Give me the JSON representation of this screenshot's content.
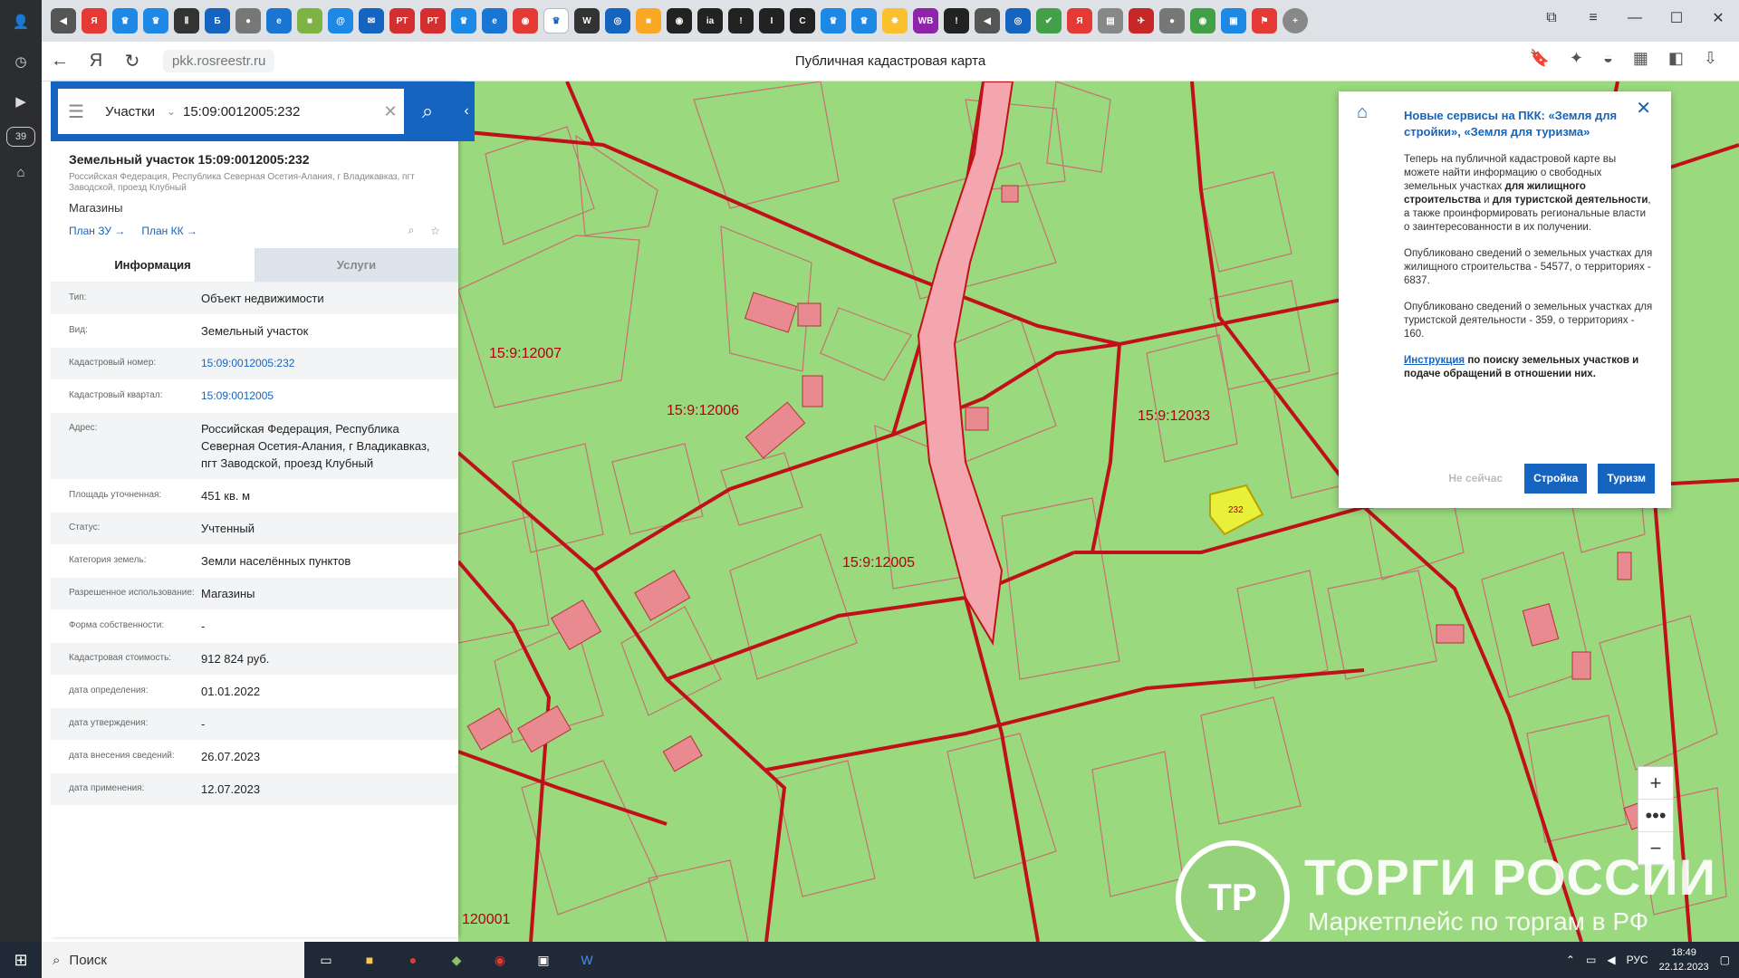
{
  "browser": {
    "url": "pkk.rosreestr.ru",
    "page_title": "Публичная кадастровая карта",
    "tab_count_badge": "39"
  },
  "search": {
    "category": "Участки",
    "query": "15:09:0012005:232"
  },
  "parcel": {
    "title": "Земельный участок 15:09:0012005:232",
    "address_short": "Российская Федерация, Республика Северная Осетия-Алания, г Владикавказ, пгт Заводской, проезд Клубный",
    "use": "Магазины",
    "plan_zu": "План ЗУ →",
    "plan_kk": "План КК →"
  },
  "tabs": {
    "info": "Информация",
    "services": "Услуги"
  },
  "info_rows": [
    {
      "key": "Тип:",
      "value": "Объект недвижимости"
    },
    {
      "key": "Вид:",
      "value": "Земельный участок"
    },
    {
      "key": "Кадастровый номер:",
      "value": "15:09:0012005:232"
    },
    {
      "key": "Кадастровый квартал:",
      "value": "15:09:0012005"
    },
    {
      "key": "Адрес:",
      "value": "Российская Федерация, Республика Северная Осетия-Алания, г Владикавказ, пгт Заводской, проезд Клубный"
    },
    {
      "key": "Площадь уточненная:",
      "value": "451 кв. м"
    },
    {
      "key": "Статус:",
      "value": "Учтенный"
    },
    {
      "key": "Категория земель:",
      "value": "Земли населённых пунктов"
    },
    {
      "key": "Разрешенное использование:",
      "value": "Магазины"
    },
    {
      "key": "Форма собственности:",
      "value": "-"
    },
    {
      "key": "Кадастровая стоимость:",
      "value": "912 824 руб."
    },
    {
      "key": "дата определения:",
      "value": "01.01.2022"
    },
    {
      "key": "дата утверждения:",
      "value": "-"
    },
    {
      "key": "дата внесения сведений:",
      "value": "26.07.2023"
    },
    {
      "key": "дата применения:",
      "value": "12.07.2023"
    }
  ],
  "map_labels": {
    "q1": "15:9:12007",
    "q2": "15:9:12006",
    "q3": "15:9:12005",
    "q4": "15:9:12033",
    "q5": "120001",
    "selected": "232"
  },
  "popup": {
    "title": "Новые сервисы на ПКК: «Земля для стройки», «Земля для туризма»",
    "p1_a": "Теперь на публичной кадастровой карте вы можете найти информацию о свободных земельных участках",
    "p1_b1": "для жилищного строительства",
    "p1_c": "и",
    "p1_b2": "для туристской деятельности",
    "p1_d": ", а также проинформировать региональные власти о заинтересованности в их получении.",
    "p2": "Опубликовано сведений о земельных участках для жилищного строительства - 54577, о территориях - 6837.",
    "p3": "Опубликовано сведений о земельных участках для туристской деятельности - 359, о территориях - 160.",
    "p4_link": "Инструкция",
    "p4_rest": "по поиску земельных участков и подаче обращений в отношении них.",
    "btn_later": "Не сейчас",
    "btn_build": "Стройка",
    "btn_tourism": "Туризм"
  },
  "watermark": {
    "title": "ТОРГИ РОССИИ",
    "subtitle": "Маркетплейс по торгам в РФ"
  },
  "taskbar": {
    "search": "Поиск",
    "lang": "РУС",
    "time": "18:49",
    "date": "22.12.2023"
  },
  "icons": [
    "back-arrow-icon",
    "refresh-icon",
    "search-icon",
    "close-icon",
    "chevron-down-icon",
    "burger-icon",
    "star-icon",
    "zoom-in-icon",
    "zoom-out-icon"
  ]
}
